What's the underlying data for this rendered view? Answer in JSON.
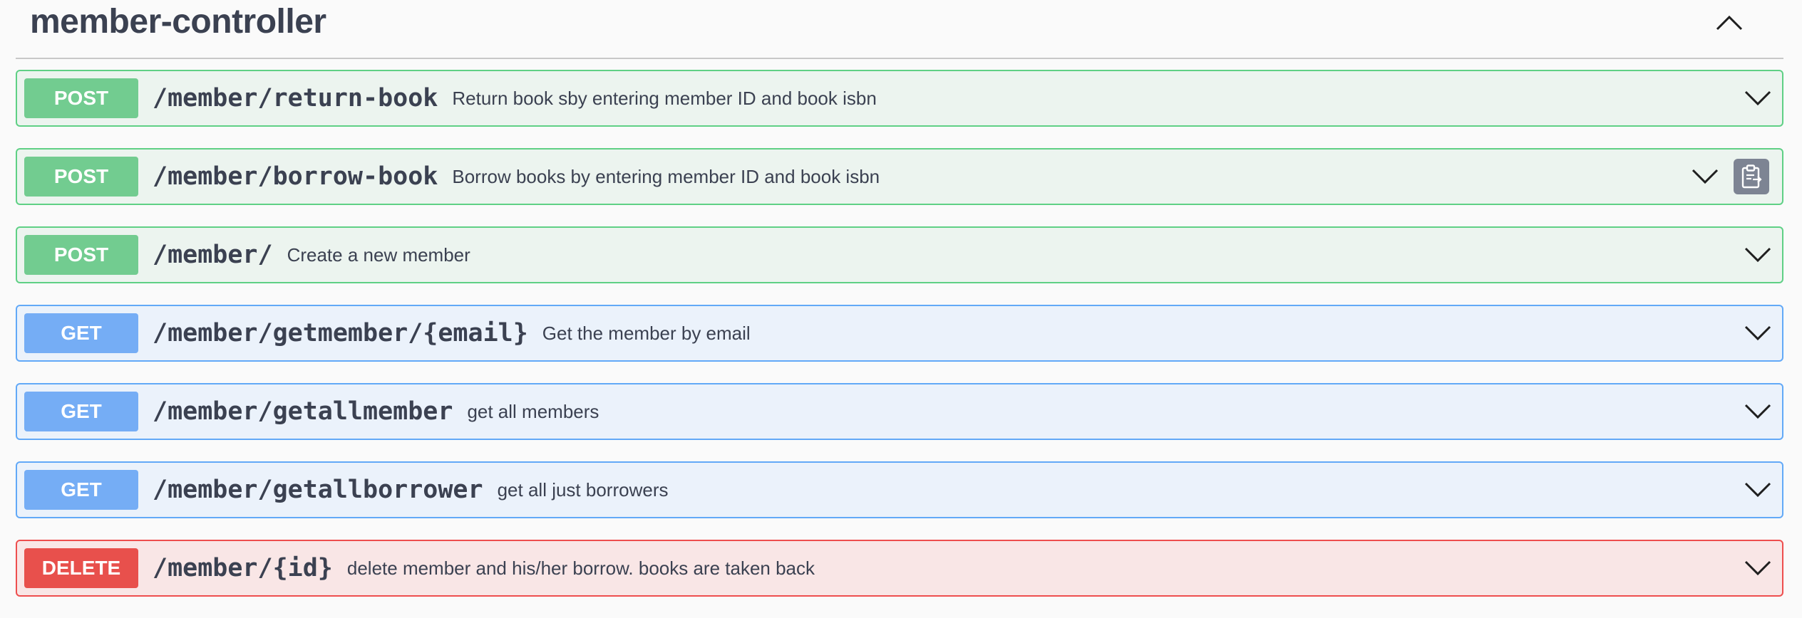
{
  "tag": {
    "title": "member-controller",
    "toggle_icon": "chevron-up-icon"
  },
  "operations": [
    {
      "method": "POST",
      "path": "/member/return-book",
      "summary": "Return book sby entering member ID and book isbn"
    },
    {
      "method": "POST",
      "path": "/member/borrow-book",
      "summary": "Borrow books by entering member ID and book isbn",
      "copy_icon": "clipboard-copy-icon"
    },
    {
      "method": "POST",
      "path": "/member/",
      "summary": "Create a new member"
    },
    {
      "method": "GET",
      "path": "/member/getmember/{email}",
      "summary": "Get the member by email"
    },
    {
      "method": "GET",
      "path": "/member/getallmember",
      "summary": "get all members"
    },
    {
      "method": "GET",
      "path": "/member/getallborrower",
      "summary": "get all just borrowers"
    },
    {
      "method": "DELETE",
      "path": "/member/{id}",
      "summary": "delete member and his/her borrow. books are taken back"
    }
  ],
  "colors": {
    "post_badge": "#72cc90",
    "post_bg": "#ecf4ef",
    "post_border": "#5fd085",
    "get_badge": "#75adf5",
    "get_bg": "#ebf2fb",
    "get_border": "#62a9f7",
    "delete_badge": "#e8504c",
    "delete_bg": "#f9e6e6",
    "delete_border": "#ee4e4e",
    "text": "#3b4151"
  }
}
